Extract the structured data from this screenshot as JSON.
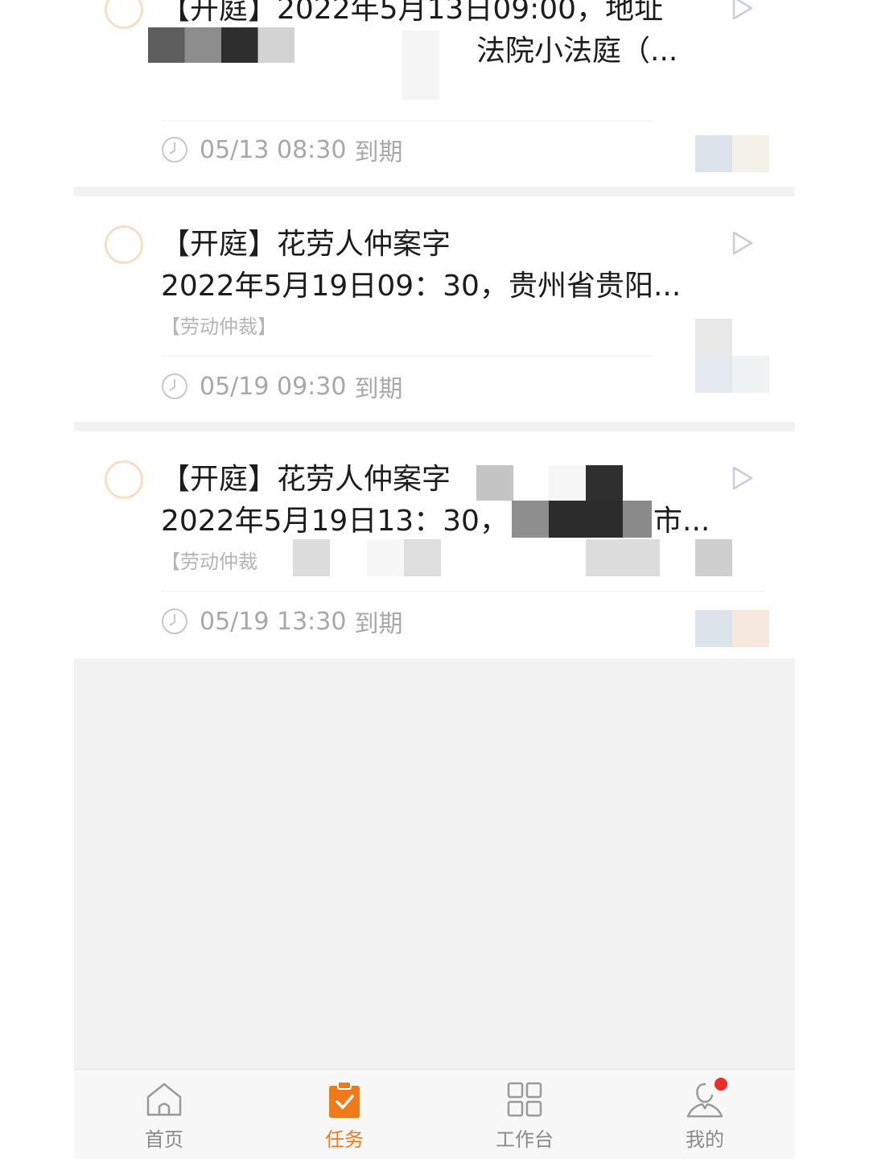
{
  "tasks": [
    {
      "title_line1": "【开庭】2022年5月13日09:00，地址",
      "title_line2": "法院小法庭（...",
      "tag": "",
      "due_time": "05/13 08:30",
      "due_suffix": "到期"
    },
    {
      "title_line1": "【开庭】花劳人仲案字",
      "title_line2": "2022年5月19日09：30，贵州省贵阳...",
      "tag": "【劳动仲裁】",
      "due_time": "05/19 09:30",
      "due_suffix": "到期"
    },
    {
      "title_line1": "【开庭】花劳人仲案字",
      "title_line2": "2022年5月19日13：30，",
      "title_line2_tail": "市...",
      "tag": "【劳动仲裁",
      "due_time": "05/19 13:30",
      "due_suffix": "到期"
    }
  ],
  "tabbar": {
    "items": [
      {
        "label": "首页",
        "icon": "home-icon",
        "active": false
      },
      {
        "label": "任务",
        "icon": "task-clipboard-icon",
        "active": true
      },
      {
        "label": "工作台",
        "icon": "grid-icon",
        "active": false
      },
      {
        "label": "我的",
        "icon": "profile-icon",
        "active": false,
        "badge": true
      }
    ]
  },
  "colors": {
    "accent": "#f07a19",
    "circle_border": "#f7dfc2",
    "muted_text": "#a8a8a8",
    "badge": "#ee2b2b",
    "background": "#f2f2f2"
  }
}
